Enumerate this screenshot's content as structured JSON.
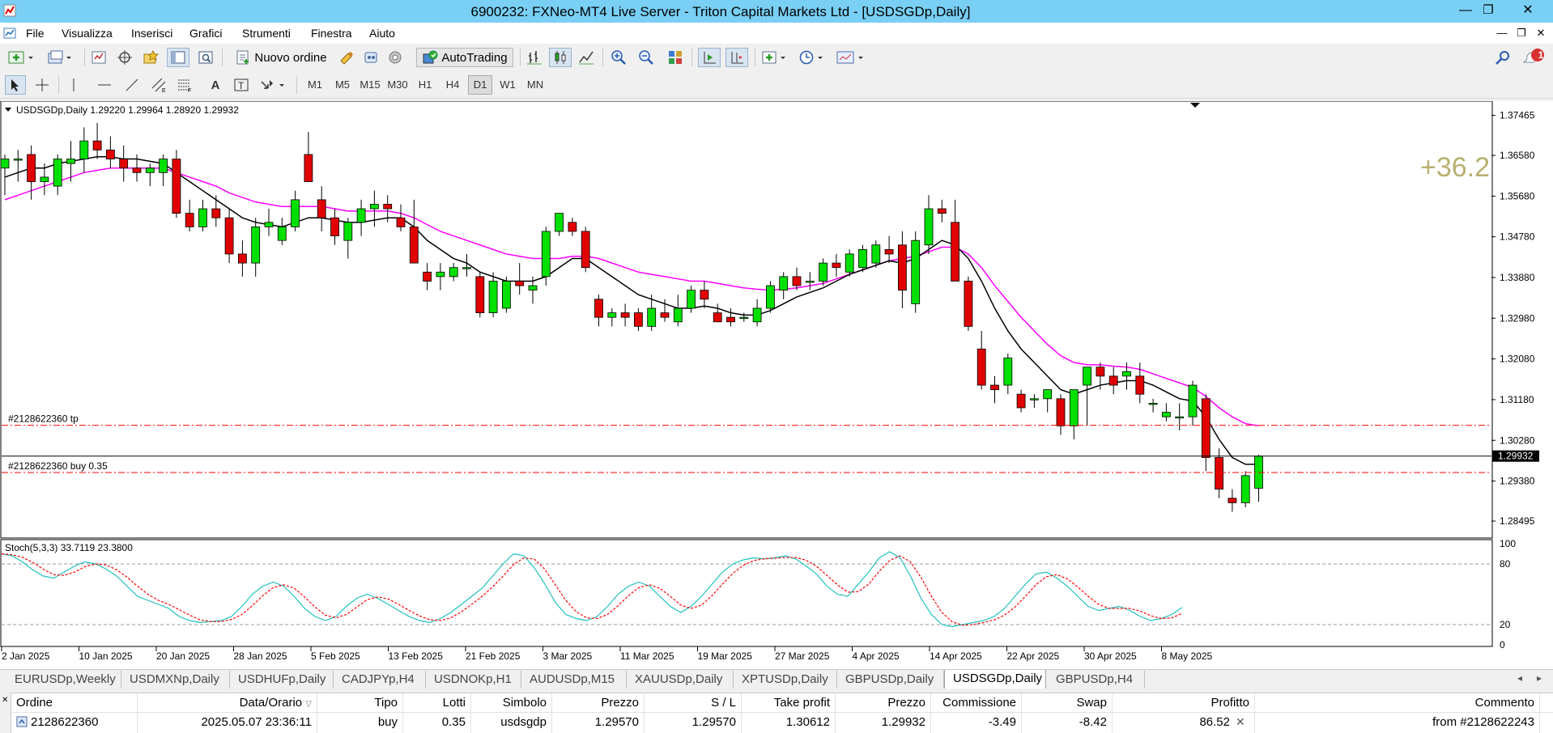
{
  "window": {
    "title": "6900232: FXNeo-MT4 Live Server - Triton Capital Markets Ltd - [USDSGDp,Daily]",
    "minimize": "—",
    "restore": "❐",
    "close": "✕"
  },
  "menu": [
    "File",
    "Visualizza",
    "Inserisci",
    "Grafici",
    "Strumenti",
    "Finestra",
    "Aiuto"
  ],
  "toolbar": {
    "new_order": "Nuovo ordine",
    "autotrading": "AutoTrading",
    "timeframes": [
      "M1",
      "M5",
      "M15",
      "M30",
      "H1",
      "H4",
      "D1",
      "W1",
      "MN"
    ],
    "active_timeframe": "D1",
    "notification_count": "1"
  },
  "chart": {
    "header": "USDSGDp,Daily  1.29220 1.29964 1.28920 1.29932",
    "profit_overlay": "+36.2",
    "current_price": "1.29932",
    "price_axis": [
      "1.37465",
      "1.36580",
      "1.35680",
      "1.34780",
      "1.33880",
      "1.32980",
      "1.32080",
      "1.31180",
      "1.30280",
      "1.29380",
      "1.28495"
    ],
    "order_labels": {
      "tp": "#2128622360 tp",
      "buy": "#2128622360 buy 0.35"
    },
    "indicator": {
      "header": "Stoch(5,3,3) 33.7119 23.3800",
      "axis": [
        "100",
        "80",
        "20",
        "0"
      ]
    },
    "date_axis": [
      "2 Jan 2025",
      "10 Jan 2025",
      "20 Jan 2025",
      "28 Jan 2025",
      "5 Feb 2025",
      "13 Feb 2025",
      "21 Feb 2025",
      "3 Mar 2025",
      "11 Mar 2025",
      "19 Mar 2025",
      "27 Mar 2025",
      "4 Apr 2025",
      "14 Apr 2025",
      "22 Apr 2025",
      "30 Apr 2025",
      "8 May 2025"
    ],
    "colors": {
      "bull": "#00e000",
      "bear": "#e00000",
      "ma_fast": "#000000",
      "ma_slow": "#ff00ff",
      "stoch_main": "#20c0c0",
      "stoch_signal": "#ff0000",
      "order_line": "#ff0000"
    }
  },
  "chart_data": {
    "type": "candlestick",
    "symbol": "USDSGDp",
    "timeframe": "Daily",
    "ylim": [
      1.2812,
      1.3778
    ],
    "ohlc": [
      [
        1.363,
        1.366,
        1.357,
        1.365
      ],
      [
        1.365,
        1.367,
        1.36,
        1.365
      ],
      [
        1.366,
        1.368,
        1.356,
        1.36
      ],
      [
        1.36,
        1.364,
        1.357,
        1.361
      ],
      [
        1.359,
        1.366,
        1.357,
        1.365
      ],
      [
        1.364,
        1.369,
        1.36,
        1.365
      ],
      [
        1.365,
        1.372,
        1.362,
        1.369
      ],
      [
        1.369,
        1.373,
        1.365,
        1.367
      ],
      [
        1.367,
        1.37,
        1.363,
        1.365
      ],
      [
        1.365,
        1.368,
        1.36,
        1.363
      ],
      [
        1.363,
        1.366,
        1.36,
        1.362
      ],
      [
        1.362,
        1.364,
        1.359,
        1.363
      ],
      [
        1.362,
        1.366,
        1.359,
        1.365
      ],
      [
        1.365,
        1.367,
        1.352,
        1.353
      ],
      [
        1.353,
        1.356,
        1.349,
        1.35
      ],
      [
        1.35,
        1.356,
        1.349,
        1.354
      ],
      [
        1.354,
        1.357,
        1.35,
        1.352
      ],
      [
        1.352,
        1.354,
        1.342,
        1.344
      ],
      [
        1.344,
        1.347,
        1.339,
        1.342
      ],
      [
        1.342,
        1.352,
        1.339,
        1.35
      ],
      [
        1.35,
        1.354,
        1.348,
        1.351
      ],
      [
        1.347,
        1.352,
        1.346,
        1.35
      ],
      [
        1.35,
        1.358,
        1.349,
        1.356
      ],
      [
        1.366,
        1.371,
        1.36,
        1.36
      ],
      [
        1.356,
        1.359,
        1.349,
        1.352
      ],
      [
        1.352,
        1.354,
        1.346,
        1.348
      ],
      [
        1.347,
        1.352,
        1.343,
        1.351
      ],
      [
        1.351,
        1.356,
        1.348,
        1.354
      ],
      [
        1.354,
        1.358,
        1.35,
        1.355
      ],
      [
        1.355,
        1.357,
        1.351,
        1.354
      ],
      [
        1.352,
        1.355,
        1.349,
        1.35
      ],
      [
        1.35,
        1.356,
        1.342,
        1.342
      ],
      [
        1.34,
        1.342,
        1.336,
        1.338
      ],
      [
        1.339,
        1.342,
        1.336,
        1.34
      ],
      [
        1.339,
        1.342,
        1.338,
        1.341
      ],
      [
        1.341,
        1.344,
        1.339,
        1.341
      ],
      [
        1.339,
        1.34,
        1.33,
        1.331
      ],
      [
        1.331,
        1.34,
        1.33,
        1.338
      ],
      [
        1.332,
        1.339,
        1.331,
        1.338
      ],
      [
        1.338,
        1.342,
        1.335,
        1.337
      ],
      [
        1.336,
        1.339,
        1.333,
        1.337
      ],
      [
        1.339,
        1.35,
        1.337,
        1.349
      ],
      [
        1.349,
        1.353,
        1.348,
        1.353
      ],
      [
        1.351,
        1.352,
        1.348,
        1.349
      ],
      [
        1.349,
        1.35,
        1.34,
        1.341
      ],
      [
        1.334,
        1.335,
        1.328,
        1.33
      ],
      [
        1.33,
        1.332,
        1.328,
        1.331
      ],
      [
        1.331,
        1.333,
        1.328,
        1.33
      ],
      [
        1.331,
        1.332,
        1.327,
        1.328
      ],
      [
        1.328,
        1.335,
        1.327,
        1.332
      ],
      [
        1.331,
        1.334,
        1.329,
        1.33
      ],
      [
        1.329,
        1.335,
        1.328,
        1.332
      ],
      [
        1.332,
        1.337,
        1.331,
        1.336
      ],
      [
        1.336,
        1.338,
        1.332,
        1.334
      ],
      [
        1.331,
        1.333,
        1.329,
        1.329
      ],
      [
        1.33,
        1.332,
        1.328,
        1.329
      ],
      [
        1.33,
        1.331,
        1.329,
        1.33
      ],
      [
        1.329,
        1.334,
        1.328,
        1.332
      ],
      [
        1.332,
        1.338,
        1.331,
        1.337
      ],
      [
        1.336,
        1.34,
        1.334,
        1.339
      ],
      [
        1.339,
        1.341,
        1.336,
        1.337
      ],
      [
        1.338,
        1.34,
        1.336,
        1.338
      ],
      [
        1.338,
        1.343,
        1.337,
        1.342
      ],
      [
        1.342,
        1.344,
        1.339,
        1.341
      ],
      [
        1.34,
        1.345,
        1.339,
        1.344
      ],
      [
        1.341,
        1.346,
        1.34,
        1.345
      ],
      [
        1.342,
        1.347,
        1.341,
        1.346
      ],
      [
        1.345,
        1.348,
        1.342,
        1.344
      ],
      [
        1.346,
        1.349,
        1.332,
        1.336
      ],
      [
        1.333,
        1.349,
        1.331,
        1.347
      ],
      [
        1.346,
        1.357,
        1.344,
        1.354
      ],
      [
        1.354,
        1.356,
        1.351,
        1.353
      ],
      [
        1.351,
        1.356,
        1.338,
        1.338
      ],
      [
        1.338,
        1.339,
        1.327,
        1.328
      ],
      [
        1.323,
        1.327,
        1.314,
        1.315
      ],
      [
        1.315,
        1.317,
        1.311,
        1.314
      ],
      [
        1.315,
        1.322,
        1.313,
        1.321
      ],
      [
        1.313,
        1.314,
        1.309,
        1.31
      ],
      [
        1.312,
        1.313,
        1.31,
        1.312
      ],
      [
        1.312,
        1.314,
        1.309,
        1.314
      ],
      [
        1.312,
        1.313,
        1.304,
        1.306
      ],
      [
        1.306,
        1.313,
        1.303,
        1.314
      ],
      [
        1.315,
        1.318,
        1.306,
        1.319
      ],
      [
        1.319,
        1.32,
        1.314,
        1.317
      ],
      [
        1.317,
        1.319,
        1.313,
        1.315
      ],
      [
        1.317,
        1.32,
        1.314,
        1.318
      ],
      [
        1.317,
        1.32,
        1.311,
        1.313
      ],
      [
        1.311,
        1.312,
        1.309,
        1.311
      ],
      [
        1.308,
        1.311,
        1.307,
        1.309
      ],
      [
        1.308,
        1.311,
        1.305,
        1.308
      ],
      [
        1.308,
        1.316,
        1.306,
        1.315
      ],
      [
        1.312,
        1.313,
        1.296,
        1.299
      ],
      [
        1.299,
        1.301,
        1.29,
        1.292
      ],
      [
        1.29,
        1.292,
        1.287,
        1.289
      ],
      [
        1.289,
        1.296,
        1.288,
        1.295
      ],
      [
        1.2922,
        1.2996,
        1.2892,
        1.2993
      ]
    ],
    "ma_fast": [
      1.361,
      1.362,
      1.363,
      1.363,
      1.364,
      1.3645,
      1.365,
      1.3655,
      1.3655,
      1.365,
      1.365,
      1.3645,
      1.364,
      1.362,
      1.36,
      1.358,
      1.356,
      1.354,
      1.352,
      1.351,
      1.3505,
      1.35,
      1.351,
      1.352,
      1.352,
      1.3515,
      1.351,
      1.351,
      1.3515,
      1.352,
      1.352,
      1.35,
      1.347,
      1.345,
      1.343,
      1.342,
      1.34,
      1.339,
      1.338,
      1.338,
      1.338,
      1.339,
      1.341,
      1.343,
      1.343,
      1.341,
      1.339,
      1.337,
      1.335,
      1.334,
      1.333,
      1.332,
      1.332,
      1.3325,
      1.332,
      1.331,
      1.3305,
      1.3305,
      1.3315,
      1.333,
      1.3345,
      1.3355,
      1.3365,
      1.338,
      1.3395,
      1.3405,
      1.3415,
      1.3425,
      1.342,
      1.343,
      1.345,
      1.347,
      1.346,
      1.343,
      1.338,
      1.332,
      1.327,
      1.323,
      1.32,
      1.317,
      1.314,
      1.313,
      1.314,
      1.315,
      1.3155,
      1.316,
      1.316,
      1.315,
      1.3135,
      1.312,
      1.3115,
      1.308,
      1.303,
      1.299,
      1.2975,
      1.2975
    ],
    "ma_slow": [
      1.356,
      1.357,
      1.358,
      1.359,
      1.36,
      1.361,
      1.362,
      1.3625,
      1.363,
      1.363,
      1.363,
      1.363,
      1.363,
      1.362,
      1.361,
      1.36,
      1.359,
      1.3575,
      1.3565,
      1.3555,
      1.355,
      1.3545,
      1.3545,
      1.3545,
      1.3545,
      1.354,
      1.3535,
      1.3535,
      1.3535,
      1.3535,
      1.353,
      1.352,
      1.3505,
      1.349,
      1.348,
      1.347,
      1.346,
      1.345,
      1.344,
      1.3435,
      1.343,
      1.343,
      1.343,
      1.3435,
      1.3435,
      1.343,
      1.342,
      1.341,
      1.34,
      1.3395,
      1.339,
      1.3385,
      1.338,
      1.338,
      1.3375,
      1.337,
      1.3365,
      1.3362,
      1.336,
      1.3362,
      1.3365,
      1.337,
      1.3375,
      1.3385,
      1.3395,
      1.3405,
      1.3415,
      1.3425,
      1.343,
      1.3435,
      1.3445,
      1.3455,
      1.3455,
      1.344,
      1.341,
      1.337,
      1.3335,
      1.33,
      1.327,
      1.324,
      1.3215,
      1.32,
      1.3195,
      1.3195,
      1.3192,
      1.319,
      1.3185,
      1.3175,
      1.3165,
      1.3155,
      1.3145,
      1.3125,
      1.31,
      1.308,
      1.3065,
      1.306
    ],
    "stoch": {
      "main": [
        90,
        88,
        82,
        74,
        68,
        66,
        72,
        78,
        82,
        80,
        75,
        68,
        58,
        48,
        44,
        40,
        36,
        28,
        24,
        22,
        23,
        24,
        28,
        38,
        50,
        58,
        62,
        58,
        48,
        36,
        28,
        24,
        28,
        38,
        46,
        50,
        46,
        40,
        34,
        28,
        24,
        22,
        26,
        32,
        40,
        48,
        56,
        68,
        80,
        90,
        88,
        76,
        60,
        42,
        30,
        26,
        24,
        28,
        38,
        50,
        58,
        62,
        58,
        48,
        38,
        32,
        38,
        48,
        60,
        72,
        80,
        84,
        86,
        85,
        86,
        88,
        85,
        78,
        70,
        58,
        50,
        48,
        60,
        72,
        86,
        92,
        86,
        68,
        46,
        30,
        20,
        18,
        20,
        22,
        24,
        28,
        36,
        48,
        60,
        70,
        72,
        66,
        58,
        48,
        38,
        34,
        36,
        38,
        34,
        28,
        24,
        26,
        30,
        37
      ]
    },
    "order": {
      "ticket": "2128622360",
      "open_price": 1.2957,
      "stop_loss": 1.2957,
      "take_profit": 1.30612,
      "current": 1.29932
    }
  },
  "tabs": [
    "EURUSDp,Weekly",
    "USDMXNp,Daily",
    "USDHUFp,Daily",
    "CADJPYp,H4",
    "USDNOKp,H1",
    "AUDUSDp,M15",
    "XAUUSDp,Daily",
    "XPTUSDp,Daily",
    "GBPUSDp,Daily",
    "USDSGDp,Daily",
    "GBPUSDp,H4"
  ],
  "active_tab": "USDSGDp,Daily",
  "orders_table": {
    "headers": [
      "Ordine",
      "Data/Orario",
      "Tipo",
      "Lotti",
      "Simbolo",
      "Prezzo",
      "S / L",
      "Take profit",
      "Prezzo",
      "Commissione",
      "Swap",
      "Profitto",
      "Commento"
    ],
    "rows": [
      [
        "2128622360",
        "2025.05.07 23:36:11",
        "buy",
        "0.35",
        "usdsgdp",
        "1.29570",
        "1.29570",
        "1.30612",
        "1.29932",
        "-3.49",
        "-8.42",
        "86.52",
        "from #2128622243"
      ]
    ]
  }
}
